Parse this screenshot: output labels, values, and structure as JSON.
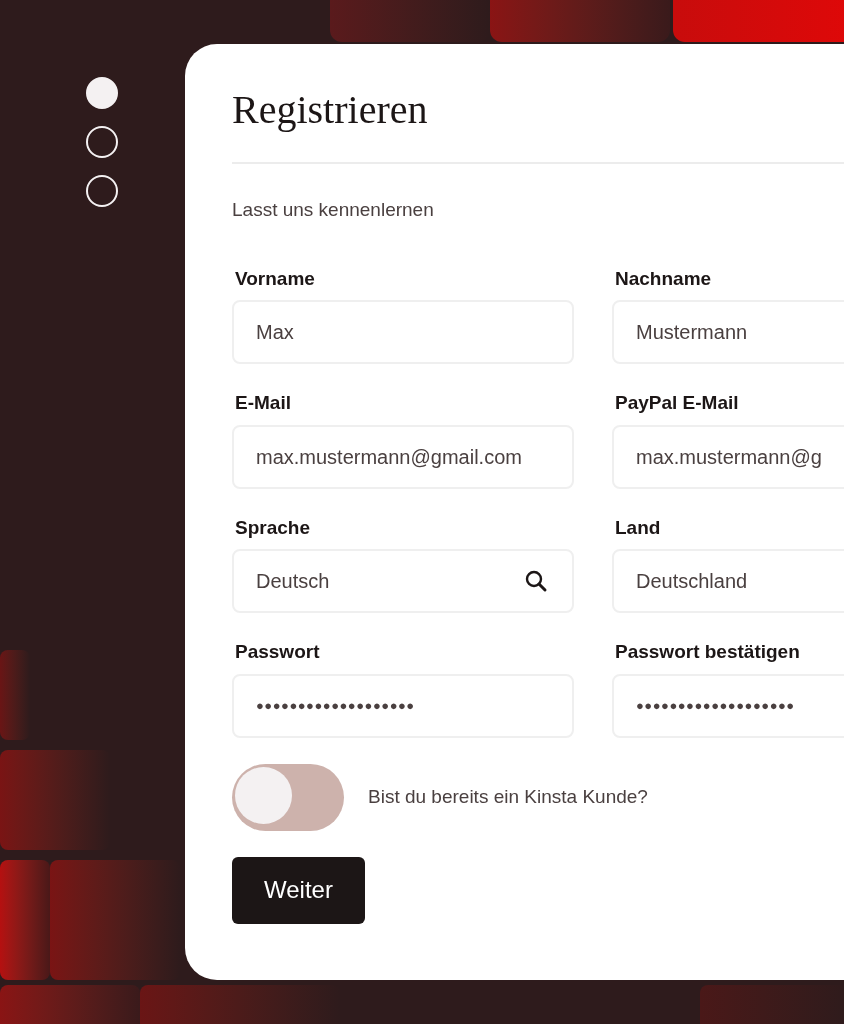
{
  "steps": [
    {
      "selected": true
    },
    {
      "selected": false
    },
    {
      "selected": false
    }
  ],
  "form": {
    "title": "Registrieren",
    "subtitle": "Lasst uns kennenlernen",
    "fields": [
      {
        "label": "Vorname",
        "value": "Max",
        "kind": "text"
      },
      {
        "label": "Nachname",
        "value": "Mustermann",
        "kind": "text"
      },
      {
        "label": "E-Mail",
        "value": "max.mustermann@gmail.com",
        "kind": "text"
      },
      {
        "label": "PayPal E-Mail",
        "value": "max.mustermann@g",
        "kind": "text"
      },
      {
        "label": "Sprache",
        "value": "Deutsch",
        "kind": "search"
      },
      {
        "label": "Land",
        "value": "Deutschland",
        "kind": "text"
      },
      {
        "label": "Passwort",
        "value": "●●●●●●●●●●●●●●●●●●●",
        "kind": "password"
      },
      {
        "label": "Passwort bestätigen",
        "value": "●●●●●●●●●●●●●●●●●●●",
        "kind": "password"
      }
    ],
    "toggle": {
      "label": "Bist du bereits ein Kinsta Kunde?",
      "on": false
    },
    "button": "Weiter"
  }
}
